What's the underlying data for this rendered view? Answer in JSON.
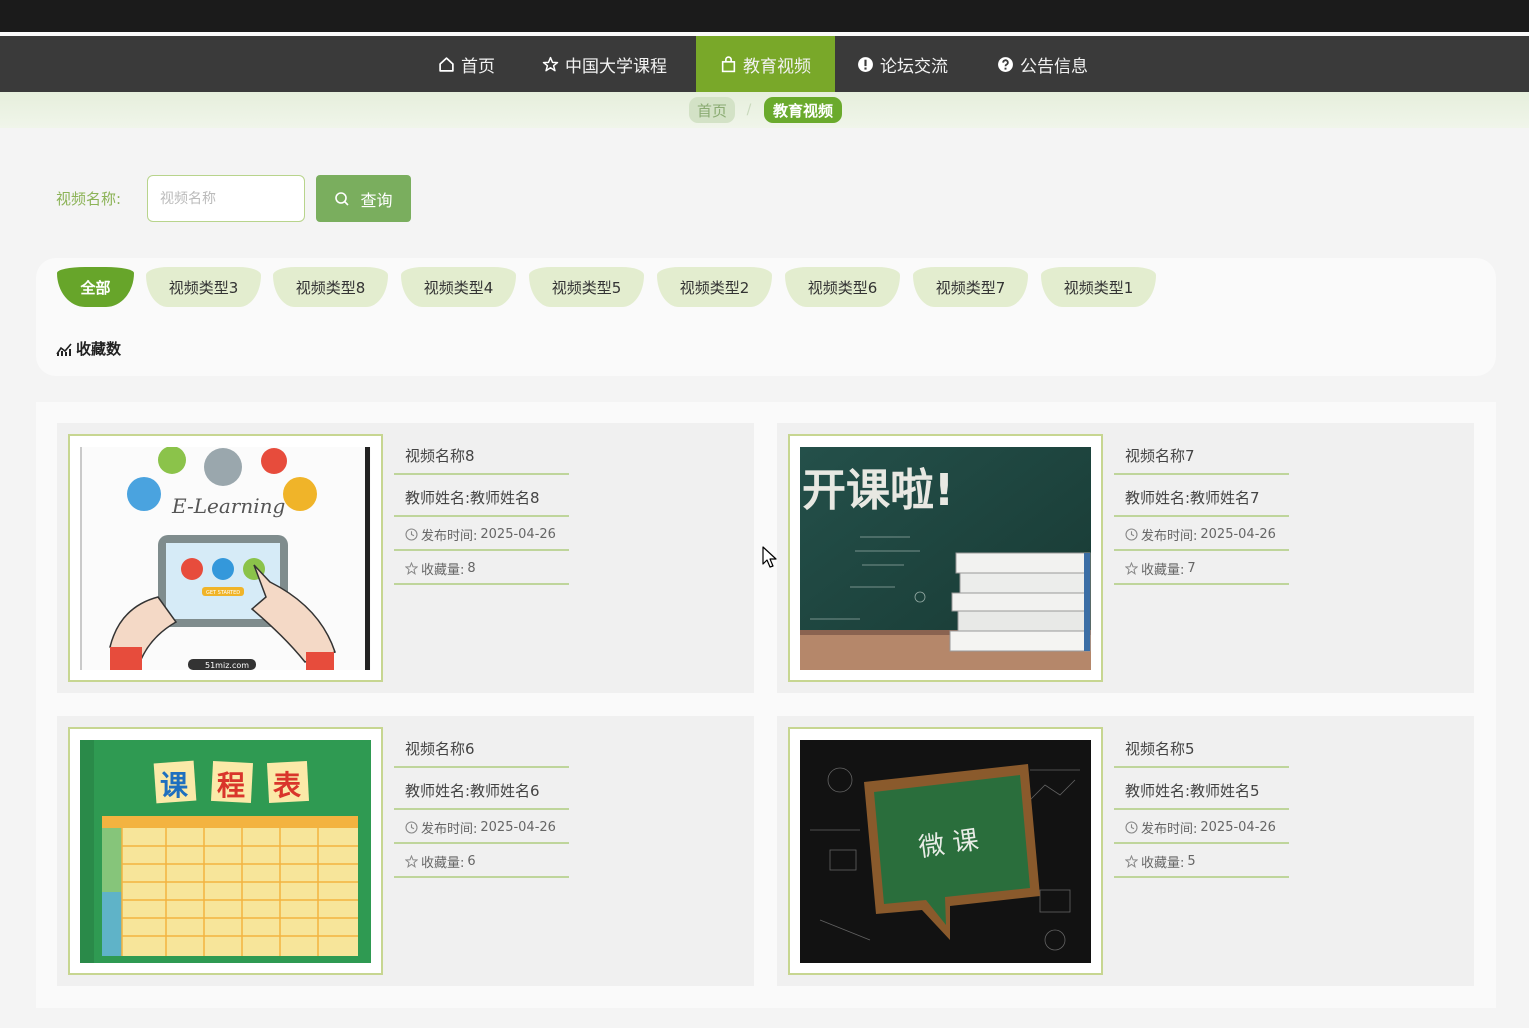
{
  "nav": {
    "items": [
      {
        "label": "首页",
        "icon": "home-icon"
      },
      {
        "label": "中国大学课程",
        "icon": "star-icon"
      },
      {
        "label": "教育视频",
        "icon": "bag-icon",
        "active": true
      },
      {
        "label": "论坛交流",
        "icon": "exclamation-icon"
      },
      {
        "label": "公告信息",
        "icon": "question-icon"
      }
    ]
  },
  "breadcrumb": {
    "home": "首页",
    "separator": "/",
    "current": "教育视频"
  },
  "search": {
    "label": "视频名称:",
    "placeholder": "视频名称",
    "value": "",
    "button": "查询"
  },
  "categories": [
    "全部",
    "视频类型3",
    "视频类型8",
    "视频类型4",
    "视频类型5",
    "视频类型2",
    "视频类型6",
    "视频类型7",
    "视频类型1"
  ],
  "active_category": "全部",
  "sort": {
    "label": "收藏数"
  },
  "videos": [
    {
      "name": "视频名称8",
      "teacher": "教师姓名:教师姓名8",
      "time_label": "发布时间:",
      "time": "2025-04-26",
      "fav_label": "收藏量:",
      "fav": "8",
      "thumb_text": "E-Learning",
      "thumb_subtext": "GET STARTED",
      "thumb_footer": "51miz.com"
    },
    {
      "name": "视频名称7",
      "teacher": "教师姓名:教师姓名7",
      "time_label": "发布时间:",
      "time": "2025-04-26",
      "fav_label": "收藏量:",
      "fav": "7",
      "thumb_text": "开课啦!"
    },
    {
      "name": "视频名称6",
      "teacher": "教师姓名:教师姓名6",
      "time_label": "发布时间:",
      "time": "2025-04-26",
      "fav_label": "收藏量:",
      "fav": "6",
      "thumb_chars": [
        "课",
        "程",
        "表"
      ]
    },
    {
      "name": "视频名称5",
      "teacher": "教师姓名:教师姓名5",
      "time_label": "发布时间:",
      "time": "2025-04-26",
      "fav_label": "收藏量:",
      "fav": "5",
      "thumb_text": "微 课"
    }
  ]
}
